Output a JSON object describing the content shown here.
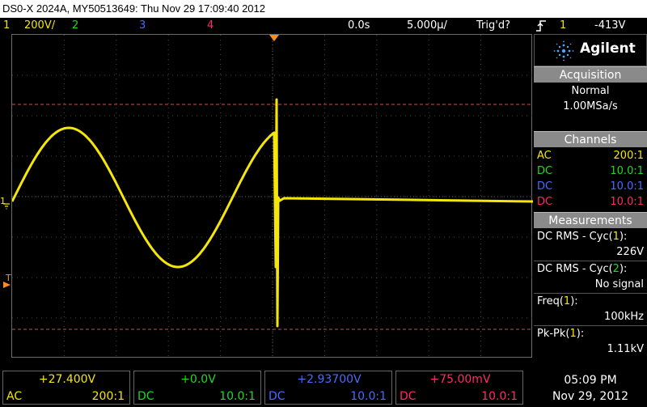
{
  "title": "DS0-X 2024A, MY50513649: Thu Nov 29 17:09:40 2012",
  "status_bar": {
    "ch1_num": "1",
    "ch1_scale": "200V/",
    "ch2_num": "2",
    "ch3_num": "3",
    "ch4_num": "4",
    "time_pos": "0.0s",
    "time_scale": "5.000µ/",
    "trig_state": "Trig'd?",
    "trig_icon": "trigger-edge-icon",
    "trig_src": "1",
    "trig_level": "-413V"
  },
  "brand": {
    "name": "Agilent"
  },
  "acquisition": {
    "header": "Acquisition",
    "mode": "Normal",
    "rate": "1.00MSa/s"
  },
  "channels": {
    "header": "Channels",
    "rows": [
      {
        "coupling": "AC",
        "probe": "200:1",
        "color": "#f5e60a"
      },
      {
        "coupling": "DC",
        "probe": "10.0:1",
        "color": "#22d822"
      },
      {
        "coupling": "DC",
        "probe": "10.0:1",
        "color": "#4a6bff"
      },
      {
        "coupling": "DC",
        "probe": "10.0:1",
        "color": "#ff2a6a"
      }
    ]
  },
  "measurements": {
    "header": "Measurements",
    "items": [
      {
        "label": "DC RMS - Cyc(",
        "ch": "1",
        "suffix": "):",
        "value": "226V"
      },
      {
        "label": "DC RMS - Cyc(",
        "ch": "2",
        "suffix": "):",
        "value": "No signal"
      },
      {
        "label": "Freq(",
        "ch": "1",
        "suffix": "):",
        "value": "100kHz"
      },
      {
        "label": "Pk-Pk(",
        "ch": "1",
        "suffix": "):",
        "value": "1.11kV"
      }
    ]
  },
  "bottom": {
    "ch1": {
      "offset": "+27.400V",
      "coupling": "AC",
      "probe": "200:1"
    },
    "ch2": {
      "offset": "+0.0V",
      "coupling": "DC",
      "probe": "10.0:1"
    },
    "ch3": {
      "offset": "+2.93700V",
      "coupling": "DC",
      "probe": "10.0:1"
    },
    "ch4": {
      "offset": "+75.00mV",
      "coupling": "DC",
      "probe": "10.0:1"
    },
    "time": "05:09 PM",
    "date": "Nov 29, 2012"
  },
  "markers": {
    "ch1_ground": "1",
    "trigger_label": "T"
  },
  "colors": {
    "ch1": "#f5e60a",
    "ch2": "#22d822",
    "ch3": "#4a6bff",
    "ch4": "#ff2a6a",
    "trigger_marker": "#ff8c1a",
    "cursor": "#c85050",
    "grid": "#4a4a4a"
  }
}
